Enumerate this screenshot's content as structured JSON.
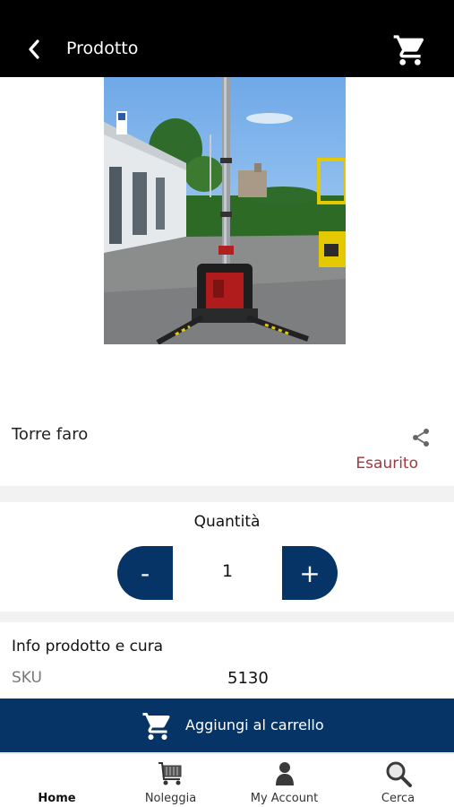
{
  "header": {
    "title": "Prodotto",
    "back_icon": "chevron-left-icon",
    "cart_icon": "cart-icon"
  },
  "product": {
    "name": "Torre faro",
    "status": "Esaurito",
    "share_icon": "share-icon"
  },
  "quantity": {
    "label": "Quantità",
    "minus_label": "-",
    "value": "1",
    "plus_label": "+"
  },
  "info": {
    "title": "Info prodotto e cura",
    "sku_label": "SKU",
    "sku_value": "5130"
  },
  "add_to_cart": {
    "label": "Aggiungi al carrello"
  },
  "nav": {
    "items": [
      {
        "label": "Home",
        "icon": "home-icon"
      },
      {
        "label": "Noleggia",
        "icon": "cart-icon"
      },
      {
        "label": "My Account",
        "icon": "user-icon"
      },
      {
        "label": "Cerca",
        "icon": "search-icon"
      }
    ]
  },
  "colors": {
    "brand_blue": "#073467",
    "status_red": "#a0393e",
    "header_bg": "#000000"
  }
}
